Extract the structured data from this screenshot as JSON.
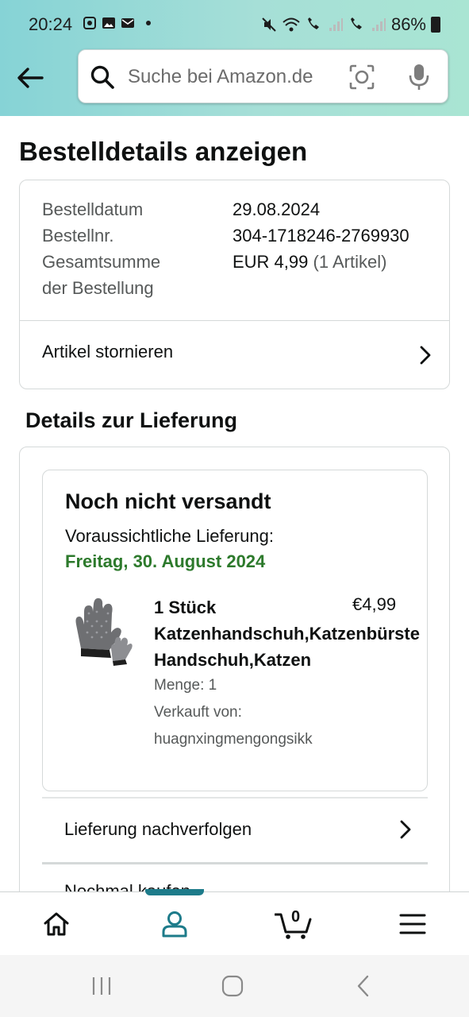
{
  "status_bar": {
    "time": "20:24",
    "battery": "86%",
    "left_icons": [
      "notification-icon",
      "image-icon",
      "mail-icon"
    ],
    "right_icons": [
      "mute-icon",
      "wifi-icon",
      "volte-1-icon",
      "signal-1-icon",
      "volte-2-icon",
      "signal-2-icon",
      "battery-icon"
    ]
  },
  "header": {
    "search_placeholder": "Suche bei Amazon.de",
    "accent_color": "#86d3d6"
  },
  "page": {
    "title": "Bestelldetails anzeigen"
  },
  "order_summary": {
    "date_label": "Bestelldatum",
    "date_value": "29.08.2024",
    "number_label": "Bestellnr.",
    "number_value": "304-1718246-2769930",
    "total_label_line1": "Gesamtsumme",
    "total_label_line2": "der Bestellung",
    "total_value": "EUR 4,99",
    "total_items": "(1 Artikel)",
    "cancel_label": "Artikel stornieren"
  },
  "delivery": {
    "section_title": "Details zur Lieferung",
    "status": "Noch nicht versandt",
    "expected_label": "Voraussichtliche Lieferung:",
    "expected_date": "Freitag, 30. August 2024",
    "expected_date_color": "#2d7a2c",
    "item": {
      "title_line1": "1 Stück",
      "title_line2": "Katzenhandschuh,Katzenbürste",
      "title_line3": "Handschuh,Katzen",
      "price": "€4,99",
      "quantity": "Menge: 1",
      "sold_by_label": "Verkauft von:",
      "seller": "huagnxingmengongsikk"
    },
    "track_label": "Lieferung nachverfolgen",
    "rebuy_label": "Nochmal kaufen"
  },
  "bottom_nav": {
    "items": [
      "home-icon",
      "account-icon",
      "cart-icon",
      "menu-icon"
    ],
    "cart_count": "0",
    "active_color": "#1d7b8a"
  },
  "system_nav": {
    "items": [
      "recents-icon",
      "home-button-icon",
      "back-icon"
    ]
  }
}
